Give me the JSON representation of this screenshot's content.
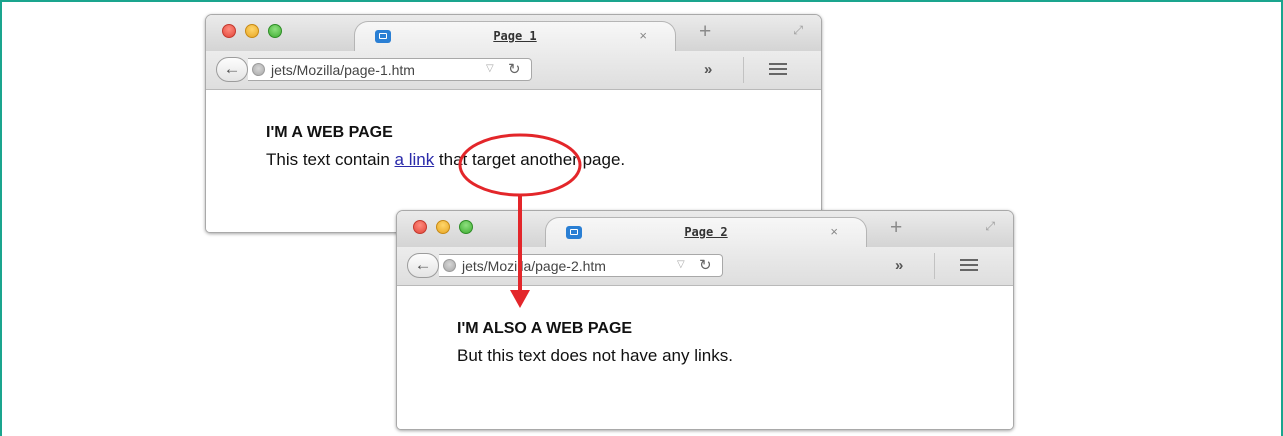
{
  "window1": {
    "tab_title": "Page 1",
    "tab_close": "×",
    "new_tab": "+",
    "url": "jets/Mozilla/page-1.htm",
    "overflow": "»",
    "heading": "I'M A WEB PAGE",
    "text_before": "This text contain ",
    "link_text": "a link",
    "text_after": " that target another page."
  },
  "window2": {
    "tab_title": "Page 2",
    "tab_close": "×",
    "new_tab": "+",
    "url": "jets/Mozilla/page-2.htm",
    "overflow": "»",
    "heading": "I'M ALSO A WEB PAGE",
    "text": "But this text does not have any links."
  },
  "annotation": {
    "color": "#e3262a",
    "meaning": "link-click-navigates-to-page-2"
  },
  "colors": {
    "frame_border": "#1aa58e",
    "link": "#2a2aaa"
  }
}
